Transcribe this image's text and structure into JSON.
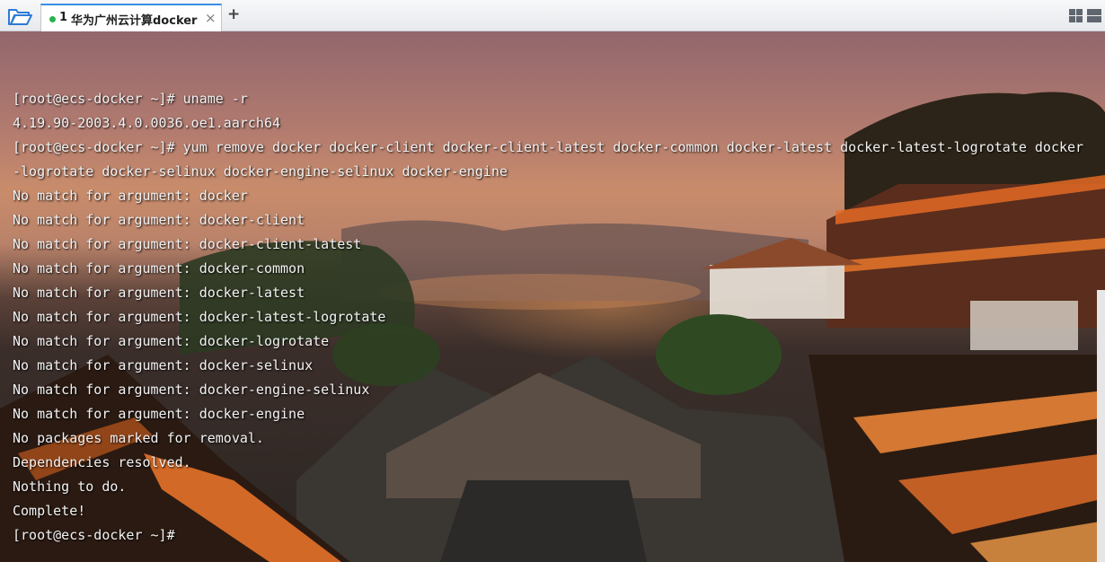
{
  "tabbar": {
    "tab": {
      "number": "1",
      "title": "华为广州云计算docker",
      "status_color": "#2bb24c",
      "close_glyph": "×"
    },
    "add_glyph": "+",
    "icons": {
      "open": "folder-open-icon",
      "layout": "layout-grid-icon"
    },
    "accent": "#3b8ee8"
  },
  "terminal": {
    "text_color": "#f2f2f2",
    "lines": [
      "[root@ecs-docker ~]# uname -r",
      "4.19.90-2003.4.0.0036.oe1.aarch64",
      "[root@ecs-docker ~]# yum remove docker docker-client docker-client-latest docker-common docker-latest docker-latest-logrotate docker",
      "-logrotate docker-selinux docker-engine-selinux docker-engine",
      "No match for argument: docker",
      "No match for argument: docker-client",
      "No match for argument: docker-client-latest",
      "No match for argument: docker-common",
      "No match for argument: docker-latest",
      "No match for argument: docker-latest-logrotate",
      "No match for argument: docker-logrotate",
      "No match for argument: docker-selinux",
      "No match for argument: docker-engine-selinux",
      "No match for argument: docker-engine",
      "No packages marked for removal.",
      "Dependencies resolved.",
      "Nothing to do.",
      "Complete!",
      "[root@ecs-docker ~]#"
    ]
  }
}
